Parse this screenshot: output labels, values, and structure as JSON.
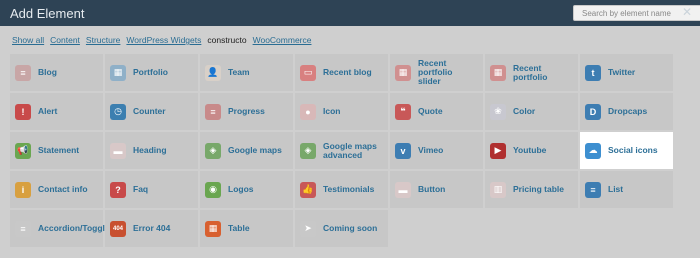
{
  "header": {
    "title": "Add Element",
    "search_placeholder": "Search by element name"
  },
  "filters": [
    "Show all",
    "Content",
    "Structure",
    "WordPress Widgets",
    "constructo",
    "WooCommerce"
  ],
  "active_filter_index": 4,
  "elements": [
    {
      "label": "Blog",
      "icon": "blog-icon",
      "color": "#c8a6a6",
      "glyph": "≡"
    },
    {
      "label": "Portfolio",
      "icon": "portfolio-icon",
      "color": "#8fb0c8",
      "glyph": "▦"
    },
    {
      "label": "Team",
      "icon": "team-icon",
      "color": "#d8d0c8",
      "glyph": "👤"
    },
    {
      "label": "Recent blog",
      "icon": "recent-blog-icon",
      "color": "#d88080",
      "glyph": "▭"
    },
    {
      "label": "Recent portfolio\nslider",
      "icon": "recent-portfolio-slider-icon",
      "color": "#d09090",
      "glyph": "▦"
    },
    {
      "label": "Recent portfolio",
      "icon": "recent-portfolio-icon",
      "color": "#d09090",
      "glyph": "▦"
    },
    {
      "label": "Twitter",
      "icon": "twitter-icon",
      "color": "#3d7db2",
      "glyph": "t"
    },
    {
      "label": "Alert",
      "icon": "alert-icon",
      "color": "#c84a4a",
      "glyph": "!"
    },
    {
      "label": "Counter",
      "icon": "counter-icon",
      "color": "#3c7fb0",
      "glyph": "◷"
    },
    {
      "label": "Progress",
      "icon": "progress-icon",
      "color": "#c88a8a",
      "glyph": "≡"
    },
    {
      "label": "Icon",
      "icon": "icon-icon",
      "color": "#d8b8b8",
      "glyph": "●"
    },
    {
      "label": "Quote",
      "icon": "quote-icon",
      "color": "#c85858",
      "glyph": "❝"
    },
    {
      "label": "Color",
      "icon": "color-icon",
      "color": "#c8c8d0",
      "glyph": "❀"
    },
    {
      "label": "Dropcaps",
      "icon": "dropcaps-icon",
      "color": "#3d7db2",
      "glyph": "D"
    },
    {
      "label": "Statement",
      "icon": "statement-icon",
      "color": "#6aa650",
      "glyph": "📢"
    },
    {
      "label": "Heading",
      "icon": "heading-icon",
      "color": "#d8c8c8",
      "glyph": "▬"
    },
    {
      "label": "Google maps",
      "icon": "google-maps-icon",
      "color": "#78a86a",
      "glyph": "◈"
    },
    {
      "label": "Google maps\nadvanced",
      "icon": "google-maps-advanced-icon",
      "color": "#78a86a",
      "glyph": "◈"
    },
    {
      "label": "Vimeo",
      "icon": "vimeo-icon",
      "color": "#3d7db2",
      "glyph": "v"
    },
    {
      "label": "Youtube",
      "icon": "youtube-icon",
      "color": "#b03030",
      "glyph": "▶"
    },
    {
      "label": "Social icons",
      "icon": "social-icons-icon",
      "color": "#3d8fd0",
      "glyph": "☁"
    },
    {
      "label": "Contact info",
      "icon": "contact-info-icon",
      "color": "#d8a040",
      "glyph": "i"
    },
    {
      "label": "Faq",
      "icon": "faq-icon",
      "color": "#c84a4a",
      "glyph": "?"
    },
    {
      "label": "Logos",
      "icon": "logos-icon",
      "color": "#6aa650",
      "glyph": "◉"
    },
    {
      "label": "Testimonials",
      "icon": "testimonials-icon",
      "color": "#c85858",
      "glyph": "👍"
    },
    {
      "label": "Button",
      "icon": "button-icon",
      "color": "#d8c8c8",
      "glyph": "▬"
    },
    {
      "label": "Pricing table",
      "icon": "pricing-table-icon",
      "color": "#d8c8c8",
      "glyph": "▥"
    },
    {
      "label": "List",
      "icon": "list-icon",
      "color": "#3d7db2",
      "glyph": "≡"
    },
    {
      "label": "Accordion/Toggle",
      "icon": "accordion-toggle-icon",
      "color": "#c8c8c8",
      "glyph": "≡"
    },
    {
      "label": "Error 404",
      "icon": "error-404-icon",
      "color": "#c85030",
      "glyph": "404"
    },
    {
      "label": "Table",
      "icon": "table-icon",
      "color": "#d86030",
      "glyph": "▦"
    },
    {
      "label": "Coming soon",
      "icon": "coming-soon-icon",
      "color": "#c8c8c8",
      "glyph": "➤"
    }
  ],
  "highlighted_index": 20
}
